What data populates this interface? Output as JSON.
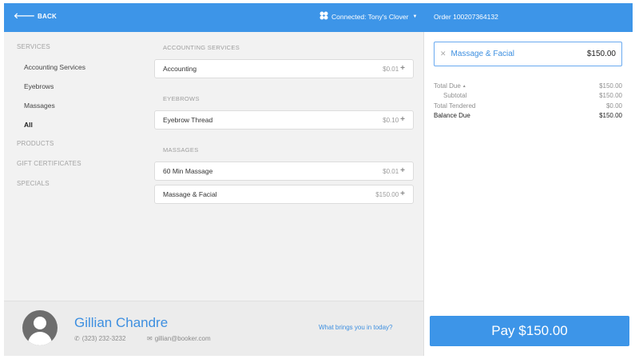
{
  "topbar": {
    "back_label": "BACK",
    "connected_label": "Connected: Tony's Clover",
    "order_label": "Order 100207364132"
  },
  "sidebar": {
    "categories": [
      {
        "label": "SERVICES"
      },
      {
        "label": "PRODUCTS"
      },
      {
        "label": "GIFT CERTIFICATES"
      },
      {
        "label": "SPECIALS"
      }
    ],
    "subitems": [
      {
        "label": "Accounting Services"
      },
      {
        "label": "Eyebrows"
      },
      {
        "label": "Massages"
      },
      {
        "label": "All",
        "active": true
      }
    ]
  },
  "catalog": {
    "sections": [
      {
        "title": "ACCOUNTING SERVICES",
        "items": [
          {
            "name": "Accounting",
            "price": "$0.01"
          }
        ]
      },
      {
        "title": "EYEBROWS",
        "items": [
          {
            "name": "Eyebrow Thread",
            "price": "$0.10"
          }
        ]
      },
      {
        "title": "MASSAGES",
        "items": [
          {
            "name": "60 Min Massage",
            "price": "$0.01"
          },
          {
            "name": "Massage & Facial",
            "price": "$150.00"
          }
        ]
      }
    ]
  },
  "cart": {
    "lines": [
      {
        "name": "Massage & Facial",
        "price": "$150.00"
      }
    ],
    "totals": [
      {
        "label": "Total Due",
        "value": "$150.00"
      },
      {
        "label": "Subtotal",
        "value": "$150.00"
      },
      {
        "label": "Total Tendered",
        "value": "$0.00"
      },
      {
        "label": "Balance Due",
        "value": "$150.00"
      }
    ],
    "pay_label": "Pay $150.00"
  },
  "customer": {
    "name": "Gillian Chandre",
    "phone": "(323) 232-3232",
    "email": "gillian@booker.com",
    "prompt": "What brings you in today?"
  },
  "colors": {
    "accent": "#3d95e8",
    "link": "#3d8fe0",
    "panel_bg": "#f2f2f2"
  },
  "icons": {
    "back": "arrow-left-icon",
    "connected": "clover-icon",
    "add": "plus-icon",
    "remove": "close-icon",
    "phone": "phone-icon",
    "email": "envelope-icon",
    "avatar": "user-avatar-icon"
  }
}
